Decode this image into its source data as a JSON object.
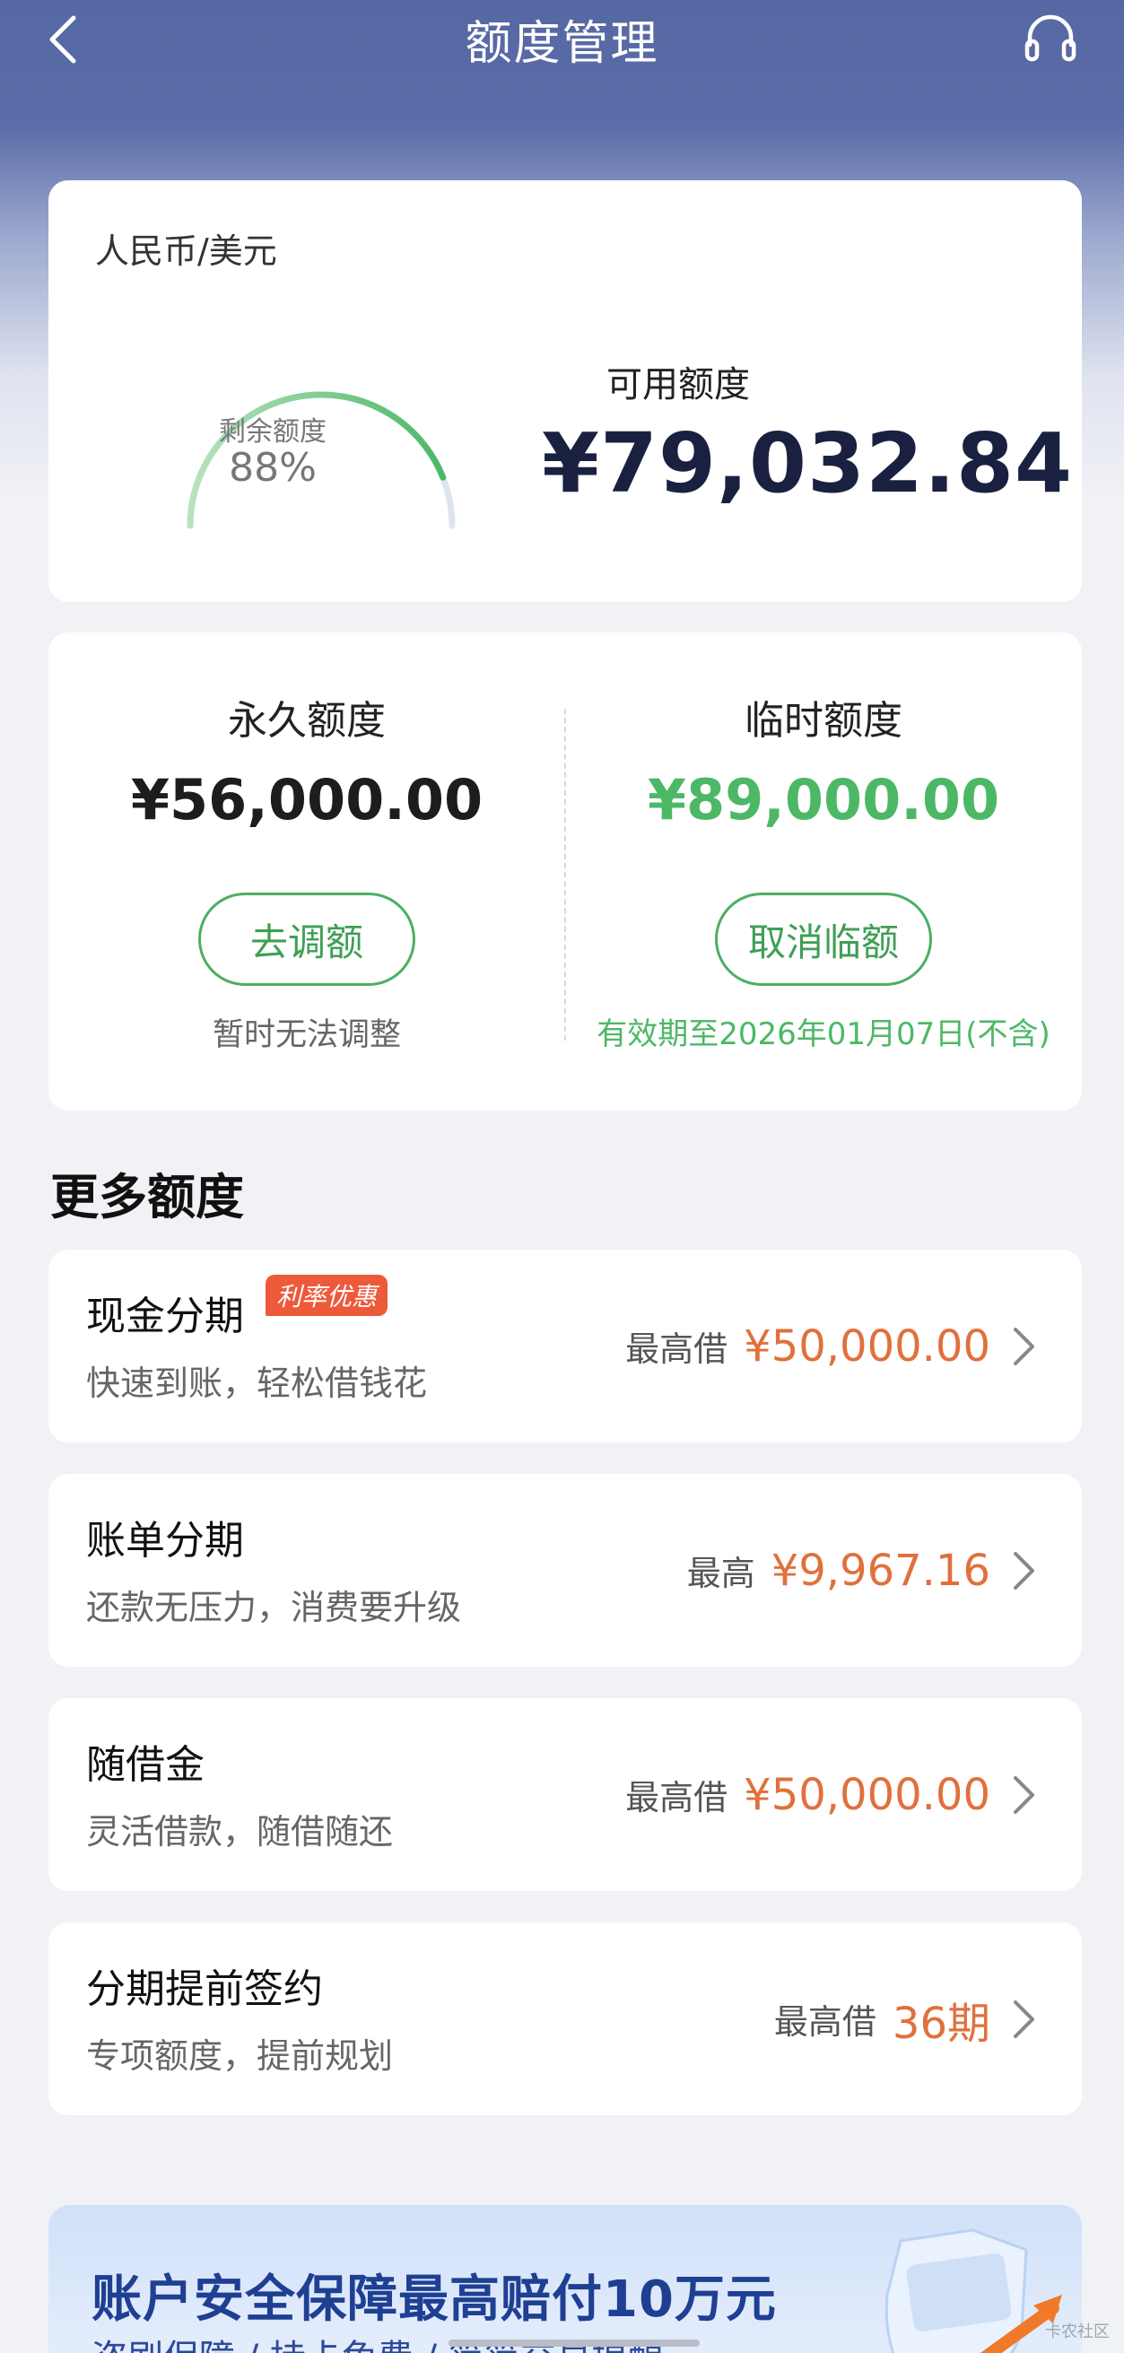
{
  "header": {
    "title": "额度管理",
    "back_icon": "chevron-left-icon",
    "support_icon": "headset-icon"
  },
  "credit": {
    "currency": "人民币/美元",
    "gauge_label": "剩余额度",
    "gauge_percent": "88%",
    "gauge_fraction": 0.88,
    "available_label": "可用额度",
    "available_value": "¥79,032.84"
  },
  "limits": {
    "permanent": {
      "label": "永久额度",
      "amount": "¥56,000.00",
      "button": "去调额",
      "note": "暂时无法调整"
    },
    "temporary": {
      "label": "临时额度",
      "amount": "¥89,000.00",
      "button": "取消临额",
      "note": "有效期至2026年01月07日(不含)"
    }
  },
  "more": {
    "title": "更多额度",
    "items": [
      {
        "title": "现金分期",
        "badge": "利率优惠",
        "subtitle": "快速到账，轻松借钱花",
        "prefix": "最高借",
        "value": "¥50,000.00"
      },
      {
        "title": "账单分期",
        "subtitle": "还款无压力，消费要升级",
        "prefix": "最高",
        "value": "¥9,967.16"
      },
      {
        "title": "随借金",
        "subtitle": "灵活借款，随借随还",
        "prefix": "最高借",
        "value": "¥50,000.00"
      },
      {
        "title": "分期提前签约",
        "subtitle": "专项额度，提前规划",
        "prefix": "最高借",
        "value": "36期"
      }
    ]
  },
  "banner": {
    "title": "账户安全保障最高赔付10万元",
    "subtitle": "盗刷保障 / 持卡免费 / 简简交易提醒"
  },
  "watermark": "卡农社区",
  "colors": {
    "header": "#5668a3",
    "accent_green": "#4cb866",
    "accent_orange": "#e0703c",
    "amount_dark": "#1a2140"
  }
}
